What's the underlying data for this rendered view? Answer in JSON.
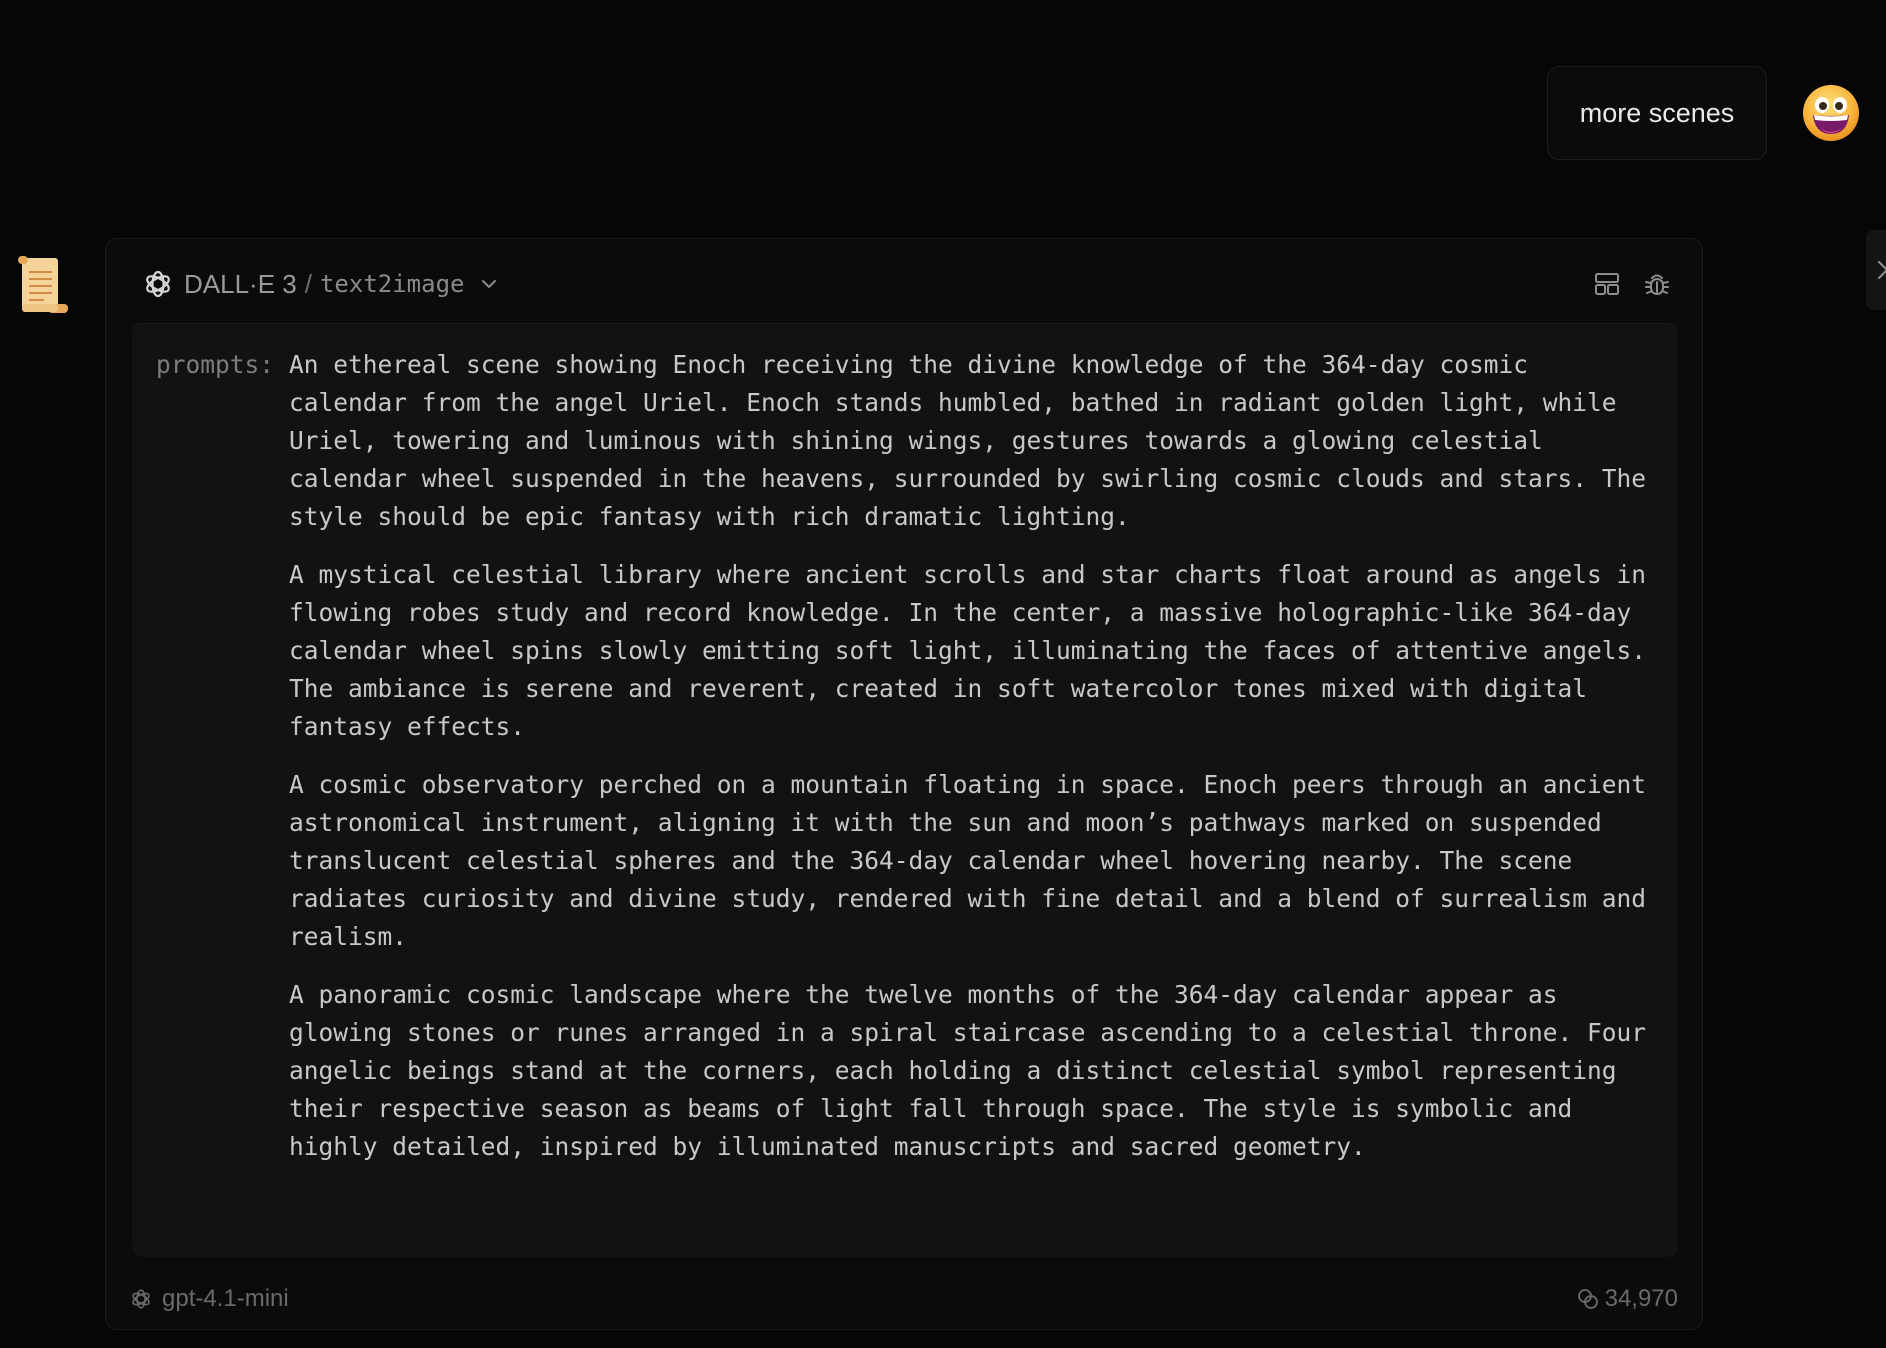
{
  "user_message": {
    "text": "more scenes",
    "avatar_icon": "grinning-face-emoji"
  },
  "assistant": {
    "avatar_icon": "scroll-emoji"
  },
  "tool_call": {
    "provider_icon": "openai-icon",
    "title": "DALL·E 3",
    "separator": "/",
    "api_name": "text2image",
    "actions": [
      "layout-icon",
      "debug-bug-icon"
    ],
    "arguments": {
      "key": "prompts:",
      "values": [
        "An ethereal scene showing Enoch receiving the divine knowledge of the 364-day cosmic calendar from the angel Uriel. Enoch stands humbled, bathed in radiant golden light, while Uriel, towering and luminous with shining wings, gestures towards a glowing celestial calendar wheel suspended in the heavens, surrounded by swirling cosmic clouds and stars. The style should be epic fantasy with rich dramatic lighting.",
        "A mystical celestial library where ancient scrolls and star charts float around as angels in flowing robes study and record knowledge. In the center, a massive holographic-like 364-day calendar wheel spins slowly emitting soft light, illuminating the faces of attentive angels. The ambiance is serene and reverent, created in soft watercolor tones mixed with digital fantasy effects.",
        "A cosmic observatory perched on a mountain floating in space. Enoch peers through an ancient astronomical instrument, aligning it with the sun and moon’s pathways marked on suspended translucent celestial spheres and the 364-day calendar wheel hovering nearby. The scene radiates curiosity and divine study, rendered with fine detail and a blend of surrealism and realism.",
        "A panoramic cosmic landscape where the twelve months of the 364-day calendar appear as glowing stones or runes arranged in a spiral staircase ascending to a celestial throne. Four angelic beings stand at the corners, each holding a distinct celestial symbol representing their respective season as beams of light fall through space. The style is symbolic and highly detailed, inspired by illuminated manuscripts and sacred geometry."
      ]
    },
    "footer": {
      "model": "gpt-4.1-mini",
      "tokens": "34,970"
    }
  },
  "colors": {
    "background": "#060606",
    "card_background": "#0b0b0b",
    "args_background": "#121212",
    "text_primary": "#c8c8c8",
    "text_muted": "#6a6a6a"
  }
}
